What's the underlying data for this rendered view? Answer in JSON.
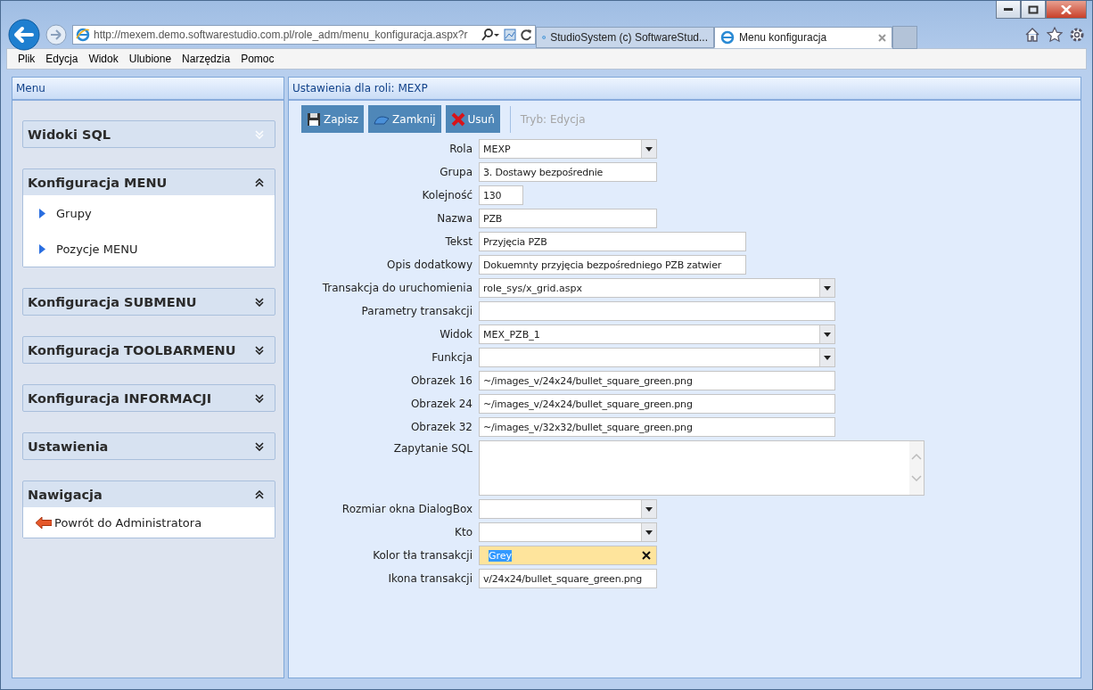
{
  "browser": {
    "url": "http://mexem.demo.softwarestudio.com.pl/role_adm/menu_konfiguracja.aspx?r",
    "tabs": [
      {
        "title": "StudioSystem (c) SoftwareStud...",
        "selected": false
      },
      {
        "title": "Menu konfiguracja",
        "selected": true
      }
    ],
    "menu": [
      "Plik",
      "Edycja",
      "Widok",
      "Ulubione",
      "Narzędzia",
      "Pomoc"
    ]
  },
  "sidebar": {
    "title": "Menu",
    "sections": [
      {
        "title": "Widoki SQL",
        "expanded": false
      },
      {
        "title": "Konfiguracja MENU",
        "expanded": true,
        "items": [
          {
            "label": "Grupy",
            "kind": "arrow"
          },
          {
            "label": "Pozycje MENU",
            "kind": "arrow"
          }
        ]
      },
      {
        "title": "Konfiguracja SUBMENU",
        "expanded": false
      },
      {
        "title": "Konfiguracja TOOLBARMENU",
        "expanded": false
      },
      {
        "title": "Konfiguracja INFORMACJI",
        "expanded": false
      },
      {
        "title": "Ustawienia",
        "expanded": false
      },
      {
        "title": "Nawigacja",
        "expanded": true,
        "items": [
          {
            "label": "Powrót do Administratora",
            "kind": "back"
          }
        ]
      }
    ]
  },
  "form": {
    "title": "Ustawienia dla roli: MEXP",
    "toolbar": [
      {
        "label": "Zapisz",
        "kind": "save"
      },
      {
        "label": "Zamknij",
        "kind": "close"
      },
      {
        "label": "Usuń",
        "kind": "delete"
      }
    ],
    "mode": "Tryb: Edycja",
    "fields": [
      {
        "label": "Rola",
        "kind": "select",
        "value": "MEXP"
      },
      {
        "label": "Grupa",
        "kind": "text",
        "value": "3. Dostawy bezpośrednie"
      },
      {
        "label": "Kolejność",
        "kind": "text",
        "value": "130"
      },
      {
        "label": "Nazwa",
        "kind": "text",
        "value": "PZB"
      },
      {
        "label": "Tekst",
        "kind": "text",
        "value": "Przyjęcia PZB"
      },
      {
        "label": "Opis dodatkowy",
        "kind": "text",
        "value": "Dokuemnty przyjęcia bezpośredniego PZB zatwier"
      },
      {
        "label": "Transakcja do uruchomienia",
        "kind": "select",
        "value": "role_sys/x_grid.aspx"
      },
      {
        "label": "Parametry transakcji",
        "kind": "text"
      },
      {
        "label": "Widok",
        "kind": "select",
        "value": "MEX_PZB_1"
      },
      {
        "label": "Funkcja",
        "kind": "select"
      },
      {
        "label": "Obrazek 16",
        "kind": "text",
        "value": "~/images_v/24x24/bullet_square_green.png"
      },
      {
        "label": "Obrazek 24",
        "kind": "text",
        "value": "~/images_v/24x24/bullet_square_green.png"
      },
      {
        "label": "Obrazek 32",
        "kind": "text",
        "value": "~/images_v/32x32/bullet_square_green.png"
      },
      {
        "label": "Zapytanie SQL",
        "kind": "textarea"
      },
      {
        "label": "Rozmiar okna DialogBox",
        "kind": "select"
      },
      {
        "label": "Kto",
        "kind": "select"
      },
      {
        "label": "Kolor tła transakcji",
        "kind": "clearable",
        "value": "Grey",
        "highlighted": true
      },
      {
        "label": "Ikona transakcji",
        "kind": "text",
        "value": "v/24x24/bullet_square_green.png"
      }
    ]
  }
}
